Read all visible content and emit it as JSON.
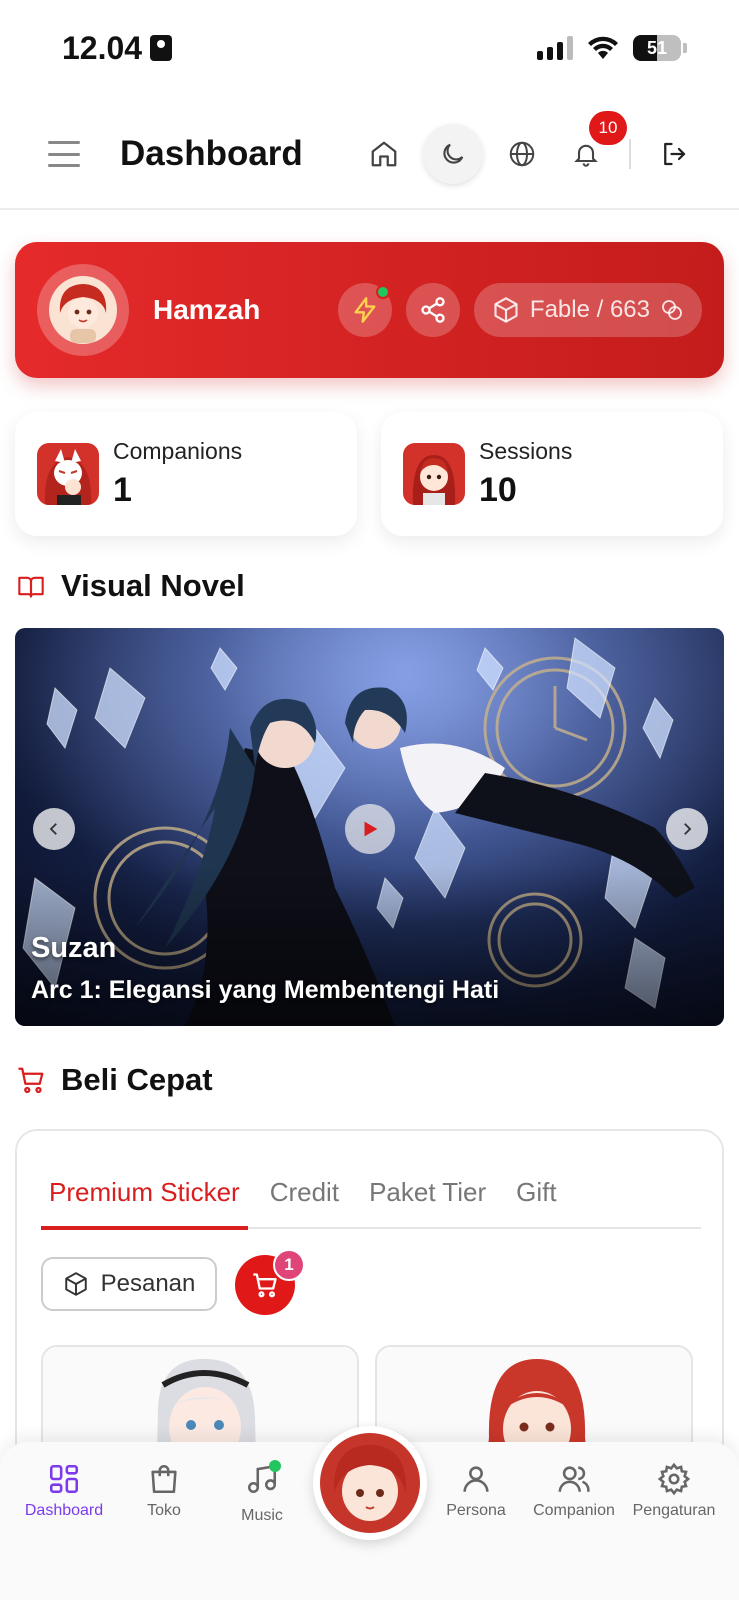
{
  "status_bar": {
    "time": "12.04",
    "battery": "51"
  },
  "header": {
    "title": "Dashboard",
    "notification_count": "10"
  },
  "profile": {
    "name": "Hamzah",
    "fable_label": "Fable / 663"
  },
  "stats": [
    {
      "label": "Companions",
      "value": "1"
    },
    {
      "label": "Sessions",
      "value": "10"
    }
  ],
  "visual_novel": {
    "section_title": "Visual Novel",
    "banner_title": "Suzan",
    "banner_subtitle": "Arc 1: Elegansi yang Membentengi Hati"
  },
  "shop": {
    "section_title": "Beli Cepat",
    "tabs": [
      "Premium Sticker",
      "Credit",
      "Paket Tier",
      "Gift"
    ],
    "active_tab": "Premium Sticker",
    "orders_label": "Pesanan",
    "cart_count": "1"
  },
  "bottom_nav": {
    "items": [
      "Dashboard",
      "Toko",
      "Music",
      "Persona",
      "Companion",
      "Pengaturan"
    ],
    "active": "Dashboard"
  },
  "colors": {
    "primary": "#d81e1e",
    "nav_active": "#7c3aed",
    "online": "#22c55e"
  }
}
